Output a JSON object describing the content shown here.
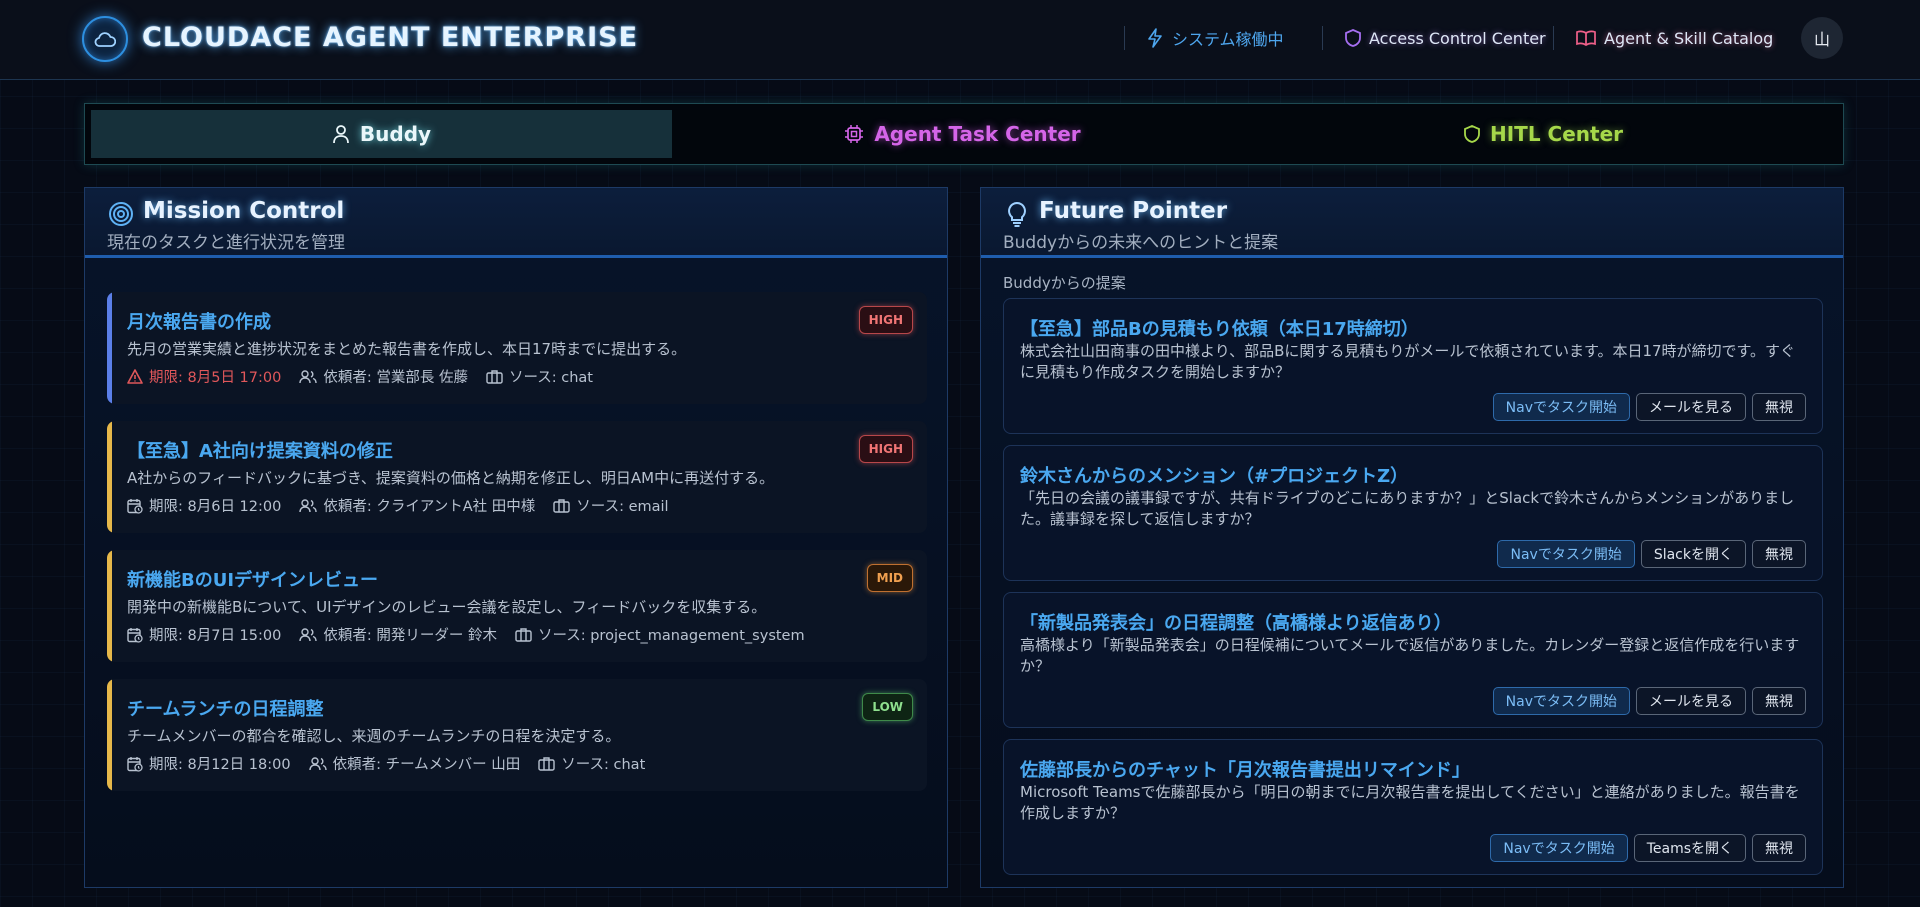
{
  "header": {
    "app_title": "CLOUDACE AGENT ENTERPRISE",
    "status": "システム稼働中",
    "access_control": "Access Control Center",
    "catalog": "Agent & Skill Catalog",
    "avatar": "山"
  },
  "tabs": [
    {
      "label": "Buddy",
      "active": true
    },
    {
      "label": "Agent Task Center",
      "active": false
    },
    {
      "label": "HITL Center",
      "active": false
    }
  ],
  "mission": {
    "title": "Mission Control",
    "subtitle": "現在のタスクと進行状況を管理",
    "tasks": [
      {
        "title": "月次報告書の作成",
        "description": "先月の営業実績と進捗状況をまとめた報告書を作成し、本日17時までに提出する。",
        "deadline": "期限: 8月5日 17:00",
        "requester": "依頼者: 営業部長 佐藤",
        "source": "ソース: chat",
        "priority": "HIGH"
      },
      {
        "title": "【至急】A社向け提案資料の修正",
        "description": "A社からのフィードバックに基づき、提案資料の価格と納期を修正し、明日AM中に再送付する。",
        "deadline": "期限: 8月6日 12:00",
        "requester": "依頼者: クライアントA社 田中様",
        "source": "ソース: email",
        "priority": "HIGH"
      },
      {
        "title": "新機能BのUIデザインレビュー",
        "description": "開発中の新機能Bについて、UIデザインのレビュー会議を設定し、フィードバックを収集する。",
        "deadline": "期限: 8月7日 15:00",
        "requester": "依頼者: 開発リーダー 鈴木",
        "source": "ソース: project_management_system",
        "priority": "MID"
      },
      {
        "title": "チームランチの日程調整",
        "description": "チームメンバーの都合を確認し、来週のチームランチの日程を決定する。",
        "deadline": "期限: 8月12日 18:00",
        "requester": "依頼者: チームメンバー 山田",
        "source": "ソース: chat",
        "priority": "LOW"
      }
    ]
  },
  "future": {
    "title": "Future Pointer",
    "subtitle": "Buddyからの未来へのヒントと提案",
    "section_label": "Buddyからの提案",
    "suggestions": [
      {
        "title": "【至急】部品Bの見積もり依頼（本日17時締切）",
        "text": "株式会社山田商事の田中様より、部品Bに関する見積もりがメールで依頼されています。本日17時が締切です。すぐに見積もり作成タスクを開始しますか？",
        "actions": [
          "Navでタスク開始",
          "メールを見る",
          "無視"
        ]
      },
      {
        "title": "鈴木さんからのメンション（#プロジェクトZ）",
        "text": "「先日の会議の議事録ですが、共有ドライブのどこにありますか？」とSlackで鈴木さんからメンションがありました。議事録を探して返信しますか？",
        "actions": [
          "Navでタスク開始",
          "Slackを開く",
          "無視"
        ]
      },
      {
        "title": "「新製品発表会」の日程調整（高橋様より返信あり）",
        "text": "高橋様より「新製品発表会」の日程候補についてメールで返信がありました。カレンダー登録と返信作成を行いますか？",
        "actions": [
          "Navでタスク開始",
          "メールを見る",
          "無視"
        ]
      },
      {
        "title": "佐藤部長からのチャット「月次報告書提出リマインド」",
        "text": "Microsoft Teamsで佐藤部長から「明日の朝までに月次報告書を提出してください」と連絡がありました。報告書を作成しますか？",
        "actions": [
          "Navでタスク開始",
          "Teamsを開く",
          "無視"
        ]
      }
    ]
  }
}
